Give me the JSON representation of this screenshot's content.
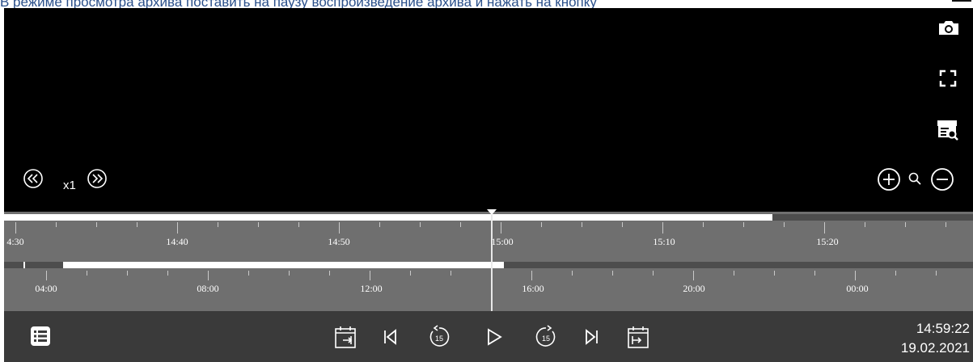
{
  "caption": {
    "text": "В режиме просмотра архива поставить на паузу воспроизведение архива и нажать на кнопку"
  },
  "player": {
    "speed": "x1",
    "right_toolbar": [
      "camera-icon",
      "fullscreen-icon",
      "archive-search-icon"
    ],
    "zoom_controls": [
      "zoom-in-icon",
      "search-icon",
      "zoom-out-icon"
    ]
  },
  "timeline": {
    "upper_scale": {
      "labels": [
        "4:30",
        "14:40",
        "14:50",
        "15:00",
        "15:10",
        "15:20"
      ],
      "recorded_fraction_end": 0.793
    },
    "lower_scale": {
      "labels": [
        "04:00",
        "08:00",
        "12:00",
        "16:00",
        "20:00",
        "00:00"
      ]
    }
  },
  "controls": {
    "buttons": [
      "menu-list-icon",
      "calendar-start-icon",
      "skip-to-start-icon",
      "rewind-15-icon",
      "play-icon",
      "forward-15-icon",
      "skip-to-end-icon",
      "calendar-end-icon"
    ],
    "rewind_seconds": "15",
    "forward_seconds": "15",
    "time": "14:59:22",
    "date": "19.02.2021"
  }
}
